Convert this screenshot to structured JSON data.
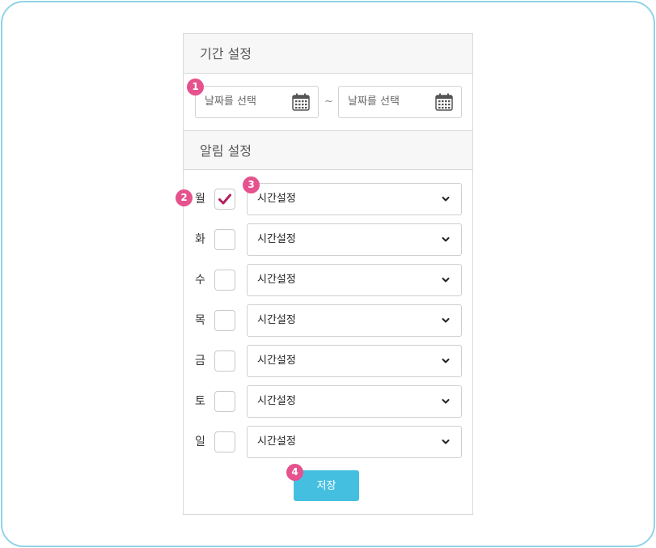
{
  "period": {
    "header": "기간 설정",
    "start_placeholder": "날짜를 선택",
    "end_placeholder": "날짜를 선택",
    "separator": "~"
  },
  "alarm": {
    "header": "알림 설정",
    "days": [
      {
        "label": "월",
        "checked": true,
        "time": "시간설정"
      },
      {
        "label": "화",
        "checked": false,
        "time": "시간설정"
      },
      {
        "label": "수",
        "checked": false,
        "time": "시간설정"
      },
      {
        "label": "목",
        "checked": false,
        "time": "시간설정"
      },
      {
        "label": "금",
        "checked": false,
        "time": "시간설정"
      },
      {
        "label": "토",
        "checked": false,
        "time": "시간설정"
      },
      {
        "label": "일",
        "checked": false,
        "time": "시간설정"
      }
    ]
  },
  "save_label": "저장",
  "badges": [
    "1",
    "2",
    "3",
    "4"
  ],
  "icons": {
    "calendar": "calendar-icon",
    "check": "checkmark-icon",
    "chevron": "chevron-down-icon"
  },
  "colors": {
    "frame_border": "#8fd3e6",
    "badge": "#e5528d",
    "save_button": "#45bfe0",
    "checkmark": "#b3205f"
  }
}
